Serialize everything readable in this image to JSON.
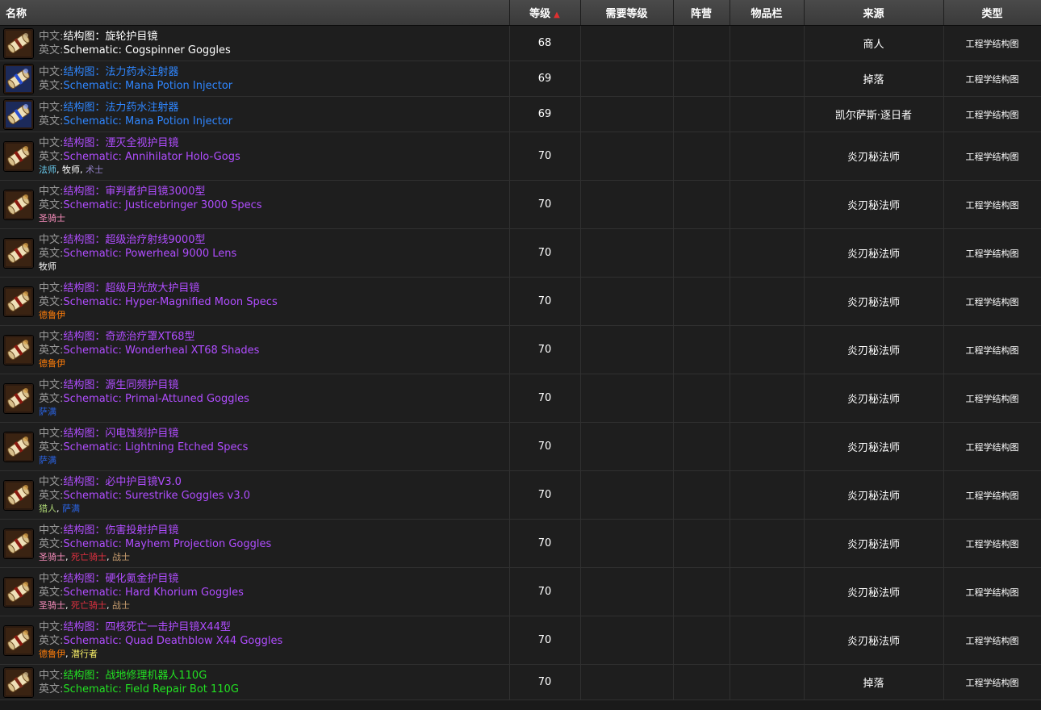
{
  "header": {
    "name": "名称",
    "level": "等级",
    "sort_arrow": "▲",
    "req_level": "需要等级",
    "faction": "阵营",
    "slot": "物品栏",
    "source": "来源",
    "type": "类型"
  },
  "labels": {
    "cn": "中文:",
    "en": "英文:"
  },
  "rows": [
    {
      "icon": "scroll-plain-icon",
      "cn": "结构图：旋轮护目镜",
      "en": "Schematic: Cogspinner Goggles",
      "quality": "white",
      "level": "68",
      "source": "商人",
      "type": "工程学结构图",
      "classes": []
    },
    {
      "icon": "scroll-blue-icon",
      "cn": "结构图：法力药水注射器",
      "en": "Schematic: Mana Potion Injector",
      "quality": "blue",
      "level": "69",
      "source": "掉落",
      "type": "工程学结构图",
      "classes": []
    },
    {
      "icon": "scroll-blue-icon",
      "cn": "结构图：法力药水注射器",
      "en": "Schematic: Mana Potion Injector",
      "quality": "blue",
      "level": "69",
      "source": "凯尔萨斯·逐日者",
      "type": "工程学结构图",
      "classes": []
    },
    {
      "icon": "scroll-orange-icon",
      "cn": "结构图：湮灭全视护目镜",
      "en": "Schematic: Annihilator Holo-Gogs",
      "quality": "purple",
      "level": "70",
      "source": "炎刃秘法师",
      "type": "工程学结构图",
      "classes": [
        {
          "name": "法师",
          "cls": "mage"
        },
        {
          "name": "牧师",
          "cls": "priest"
        },
        {
          "name": "术士",
          "cls": "warlock"
        }
      ]
    },
    {
      "icon": "scroll-orange-icon",
      "cn": "结构图：审判者护目镜3000型",
      "en": "Schematic: Justicebringer 3000 Specs",
      "quality": "purple",
      "level": "70",
      "source": "炎刃秘法师",
      "type": "工程学结构图",
      "classes": [
        {
          "name": "圣骑士",
          "cls": "paladin"
        }
      ]
    },
    {
      "icon": "scroll-orange-icon",
      "cn": "结构图：超级治疗射线9000型",
      "en": "Schematic: Powerheal 9000 Lens",
      "quality": "purple",
      "level": "70",
      "source": "炎刃秘法师",
      "type": "工程学结构图",
      "classes": [
        {
          "name": "牧师",
          "cls": "priest"
        }
      ]
    },
    {
      "icon": "scroll-orange-icon",
      "cn": "结构图：超级月光放大护目镜",
      "en": "Schematic: Hyper-Magnified Moon Specs",
      "quality": "purple",
      "level": "70",
      "source": "炎刃秘法师",
      "type": "工程学结构图",
      "classes": [
        {
          "name": "德鲁伊",
          "cls": "druid"
        }
      ]
    },
    {
      "icon": "scroll-orange-icon",
      "cn": "结构图：奇迹治疗罩XT68型",
      "en": "Schematic: Wonderheal XT68 Shades",
      "quality": "purple",
      "level": "70",
      "source": "炎刃秘法师",
      "type": "工程学结构图",
      "classes": [
        {
          "name": "德鲁伊",
          "cls": "druid"
        }
      ]
    },
    {
      "icon": "scroll-orange-icon",
      "cn": "结构图：源生同频护目镜",
      "en": "Schematic: Primal-Attuned Goggles",
      "quality": "purple",
      "level": "70",
      "source": "炎刃秘法师",
      "type": "工程学结构图",
      "classes": [
        {
          "name": "萨满",
          "cls": "shaman"
        }
      ]
    },
    {
      "icon": "scroll-orange-icon",
      "cn": "结构图：闪电蚀刻护目镜",
      "en": "Schematic: Lightning Etched Specs",
      "quality": "purple",
      "level": "70",
      "source": "炎刃秘法师",
      "type": "工程学结构图",
      "classes": [
        {
          "name": "萨满",
          "cls": "shaman"
        }
      ]
    },
    {
      "icon": "scroll-orange-icon",
      "cn": "结构图：必中护目镜V3.0",
      "en": "Schematic: Surestrike Goggles v3.0",
      "quality": "purple",
      "level": "70",
      "source": "炎刃秘法师",
      "type": "工程学结构图",
      "classes": [
        {
          "name": "猎人",
          "cls": "hunter"
        },
        {
          "name": "萨满",
          "cls": "shaman"
        }
      ]
    },
    {
      "icon": "scroll-orange-icon",
      "cn": "结构图：伤害投射护目镜",
      "en": "Schematic: Mayhem Projection Goggles",
      "quality": "purple",
      "level": "70",
      "source": "炎刃秘法师",
      "type": "工程学结构图",
      "classes": [
        {
          "name": "圣骑士",
          "cls": "paladin"
        },
        {
          "name": "死亡骑士",
          "cls": "dk"
        },
        {
          "name": "战士",
          "cls": "warrior"
        }
      ]
    },
    {
      "icon": "scroll-orange-icon",
      "cn": "结构图：硬化氪金护目镜",
      "en": "Schematic: Hard Khorium Goggles",
      "quality": "purple",
      "level": "70",
      "source": "炎刃秘法师",
      "type": "工程学结构图",
      "classes": [
        {
          "name": "圣骑士",
          "cls": "paladin"
        },
        {
          "name": "死亡骑士",
          "cls": "dk"
        },
        {
          "name": "战士",
          "cls": "warrior"
        }
      ]
    },
    {
      "icon": "scroll-orange-icon",
      "cn": "结构图：四核死亡一击护目镜X44型",
      "en": "Schematic: Quad Deathblow X44 Goggles",
      "quality": "purple",
      "level": "70",
      "source": "炎刃秘法师",
      "type": "工程学结构图",
      "classes": [
        {
          "name": "德鲁伊",
          "cls": "druid"
        },
        {
          "name": "潜行者",
          "cls": "rogue"
        }
      ]
    },
    {
      "icon": "scroll-plain-icon",
      "cn": "结构图：战地修理机器人110G",
      "en": "Schematic: Field Repair Bot 110G",
      "quality": "green",
      "level": "70",
      "source": "掉落",
      "type": "工程学结构图",
      "classes": []
    }
  ],
  "colors": {
    "white": "#ffffff",
    "blue": "#2f86ff",
    "purple": "#b04dff",
    "green": "#22e022",
    "header_bg": "#404040",
    "row_bg": "#1e1e1e",
    "grid": "#303030"
  }
}
